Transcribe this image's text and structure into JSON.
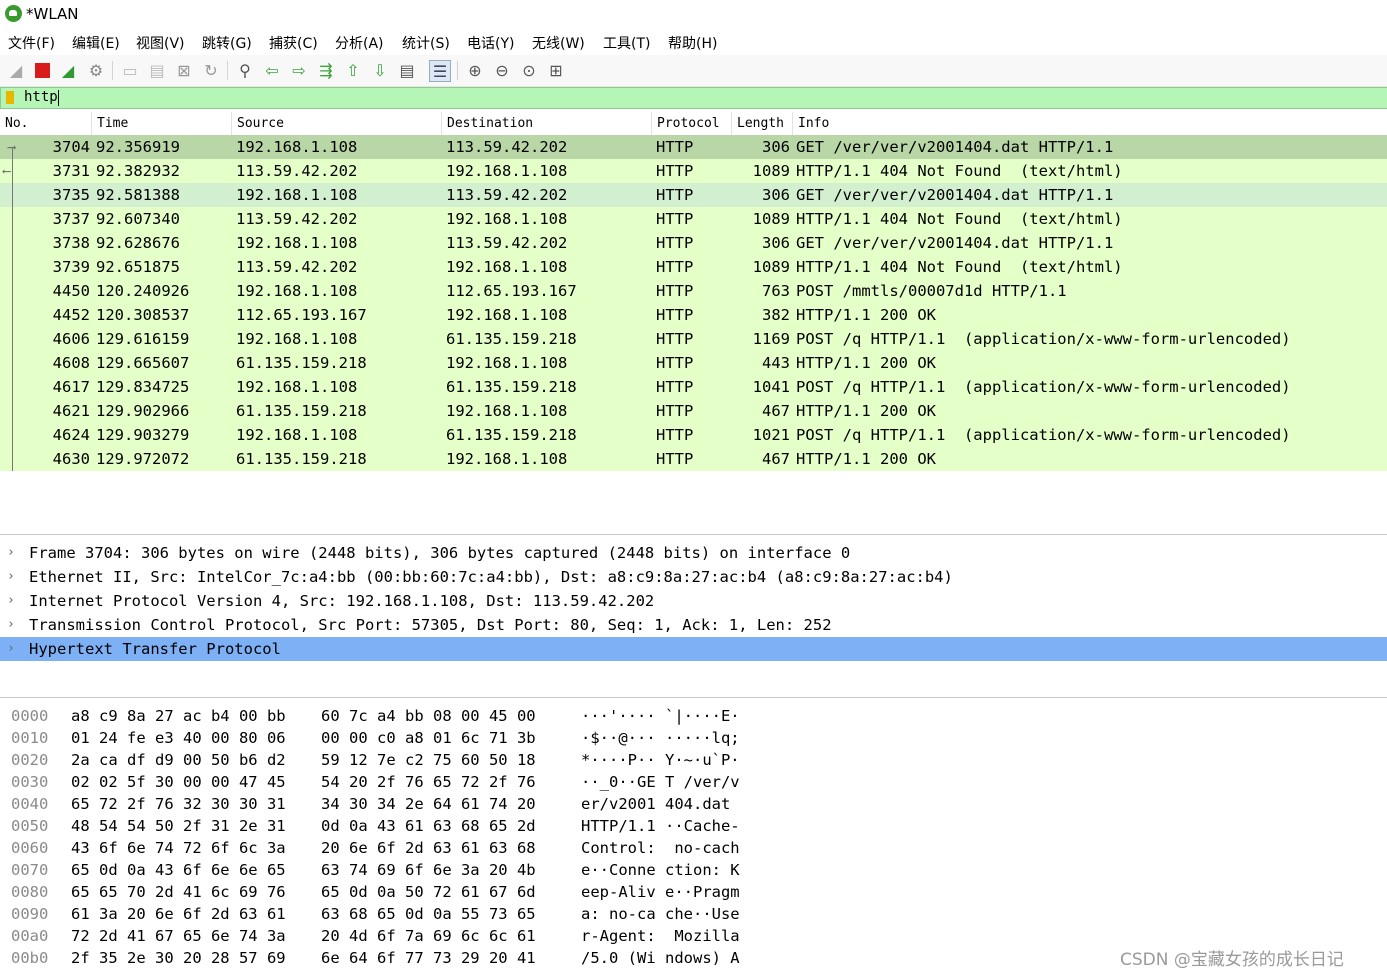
{
  "window": {
    "title": "*WLAN"
  },
  "menu": [
    "文件(F)",
    "编辑(E)",
    "视图(V)",
    "跳转(G)",
    "捕获(C)",
    "分析(A)",
    "统计(S)",
    "电话(Y)",
    "无线(W)",
    "工具(T)",
    "帮助(H)"
  ],
  "toolbar": {
    "icons": [
      "shark-fin-start-icon",
      "stop-capture-icon",
      "restart-capture-icon",
      "capture-options-icon",
      "open-file-icon",
      "save-file-icon",
      "close-file-icon",
      "reload-file-icon",
      "find-packet-icon",
      "go-back-icon",
      "go-forward-icon",
      "go-to-packet-icon",
      "go-first-icon",
      "go-last-icon",
      "autoscroll-icon",
      "colorize-icon",
      "zoom-in-icon",
      "zoom-out-icon",
      "zoom-normal-icon",
      "resize-columns-icon"
    ]
  },
  "filter": {
    "value": "http"
  },
  "columns": [
    "No.",
    "Time",
    "Source",
    "Destination",
    "Protocol",
    "Length",
    "Info"
  ],
  "packets": [
    {
      "no": "3704",
      "time": "92.356919",
      "src": "192.168.1.108",
      "dst": "113.59.42.202",
      "proto": "HTTP",
      "len": "306",
      "info": "GET /ver/ver/v2001404.dat HTTP/1.1"
    },
    {
      "no": "3731",
      "time": "92.382932",
      "src": "113.59.42.202",
      "dst": "192.168.1.108",
      "proto": "HTTP",
      "len": "1089",
      "info": "HTTP/1.1 404 Not Found  (text/html)"
    },
    {
      "no": "3735",
      "time": "92.581388",
      "src": "192.168.1.108",
      "dst": "113.59.42.202",
      "proto": "HTTP",
      "len": "306",
      "info": "GET /ver/ver/v2001404.dat HTTP/1.1"
    },
    {
      "no": "3737",
      "time": "92.607340",
      "src": "113.59.42.202",
      "dst": "192.168.1.108",
      "proto": "HTTP",
      "len": "1089",
      "info": "HTTP/1.1 404 Not Found  (text/html)"
    },
    {
      "no": "3738",
      "time": "92.628676",
      "src": "192.168.1.108",
      "dst": "113.59.42.202",
      "proto": "HTTP",
      "len": "306",
      "info": "GET /ver/ver/v2001404.dat HTTP/1.1"
    },
    {
      "no": "3739",
      "time": "92.651875",
      "src": "113.59.42.202",
      "dst": "192.168.1.108",
      "proto": "HTTP",
      "len": "1089",
      "info": "HTTP/1.1 404 Not Found  (text/html)"
    },
    {
      "no": "4450",
      "time": "120.240926",
      "src": "192.168.1.108",
      "dst": "112.65.193.167",
      "proto": "HTTP",
      "len": "763",
      "info": "POST /mmtls/00007d1d HTTP/1.1"
    },
    {
      "no": "4452",
      "time": "120.308537",
      "src": "112.65.193.167",
      "dst": "192.168.1.108",
      "proto": "HTTP",
      "len": "382",
      "info": "HTTP/1.1 200 OK"
    },
    {
      "no": "4606",
      "time": "129.616159",
      "src": "192.168.1.108",
      "dst": "61.135.159.218",
      "proto": "HTTP",
      "len": "1169",
      "info": "POST /q HTTP/1.1  (application/x-www-form-urlencoded)"
    },
    {
      "no": "4608",
      "time": "129.665607",
      "src": "61.135.159.218",
      "dst": "192.168.1.108",
      "proto": "HTTP",
      "len": "443",
      "info": "HTTP/1.1 200 OK"
    },
    {
      "no": "4617",
      "time": "129.834725",
      "src": "192.168.1.108",
      "dst": "61.135.159.218",
      "proto": "HTTP",
      "len": "1041",
      "info": "POST /q HTTP/1.1  (application/x-www-form-urlencoded)"
    },
    {
      "no": "4621",
      "time": "129.902966",
      "src": "61.135.159.218",
      "dst": "192.168.1.108",
      "proto": "HTTP",
      "len": "467",
      "info": "HTTP/1.1 200 OK"
    },
    {
      "no": "4624",
      "time": "129.903279",
      "src": "192.168.1.108",
      "dst": "61.135.159.218",
      "proto": "HTTP",
      "len": "1021",
      "info": "POST /q HTTP/1.1  (application/x-www-form-urlencoded)"
    },
    {
      "no": "4630",
      "time": "129.972072",
      "src": "61.135.159.218",
      "dst": "192.168.1.108",
      "proto": "HTTP",
      "len": "467",
      "info": "HTTP/1.1 200 OK"
    }
  ],
  "details": [
    "Frame 3704: 306 bytes on wire (2448 bits), 306 bytes captured (2448 bits) on interface 0",
    "Ethernet II, Src: IntelCor_7c:a4:bb (00:bb:60:7c:a4:bb), Dst: a8:c9:8a:27:ac:b4 (a8:c9:8a:27:ac:b4)",
    "Internet Protocol Version 4, Src: 192.168.1.108, Dst: 113.59.42.202",
    "Transmission Control Protocol, Src Port: 57305, Dst Port: 80, Seq: 1, Ack: 1, Len: 252",
    "Hypertext Transfer Protocol"
  ],
  "bytes": [
    {
      "off": "0000",
      "h1": "a8 c9 8a 27 ac b4 00 bb",
      "h2": "60 7c a4 bb 08 00 45 00",
      "ascii": "···'···· `|····E·"
    },
    {
      "off": "0010",
      "h1": "01 24 fe e3 40 00 80 06",
      "h2": "00 00 c0 a8 01 6c 71 3b",
      "ascii": "·$··@··· ·····lq;"
    },
    {
      "off": "0020",
      "h1": "2a ca df d9 00 50 b6 d2",
      "h2": "59 12 7e c2 75 60 50 18",
      "ascii": "*····P·· Y·~·u`P·"
    },
    {
      "off": "0030",
      "h1": "02 02 5f 30 00 00 47 45",
      "h2": "54 20 2f 76 65 72 2f 76",
      "ascii": "··_0··GE T /ver/v"
    },
    {
      "off": "0040",
      "h1": "65 72 2f 76 32 30 30 31",
      "h2": "34 30 34 2e 64 61 74 20",
      "ascii": "er/v2001 404.dat "
    },
    {
      "off": "0050",
      "h1": "48 54 54 50 2f 31 2e 31",
      "h2": "0d 0a 43 61 63 68 65 2d",
      "ascii": "HTTP/1.1 ··Cache-"
    },
    {
      "off": "0060",
      "h1": "43 6f 6e 74 72 6f 6c 3a",
      "h2": "20 6e 6f 2d 63 61 63 68",
      "ascii": "Control:  no-cach"
    },
    {
      "off": "0070",
      "h1": "65 0d 0a 43 6f 6e 6e 65",
      "h2": "63 74 69 6f 6e 3a 20 4b",
      "ascii": "e··Conne ction: K"
    },
    {
      "off": "0080",
      "h1": "65 65 70 2d 41 6c 69 76",
      "h2": "65 0d 0a 50 72 61 67 6d",
      "ascii": "eep-Aliv e··Pragm"
    },
    {
      "off": "0090",
      "h1": "61 3a 20 6e 6f 2d 63 61",
      "h2": "63 68 65 0d 0a 55 73 65",
      "ascii": "a: no-ca che··Use"
    },
    {
      "off": "00a0",
      "h1": "72 2d 41 67 65 6e 74 3a",
      "h2": "20 4d 6f 7a 69 6c 6c 61",
      "ascii": "r-Agent:  Mozilla"
    },
    {
      "off": "00b0",
      "h1": "2f 35 2e 30 20 28 57 69",
      "h2": "6e 64 6f 77 73 29 20 41",
      "ascii": "/5.0 (Wi ndows) A"
    }
  ],
  "watermark": "CSDN @宝藏女孩的成长日记",
  "colors": {
    "row_bg": "#e4ffc7",
    "row_selected": "#b8d6a6",
    "row_related": "#d2f0d0",
    "filter_ok": "#b5f5b5",
    "detail_selected": "#7eb0f5"
  }
}
